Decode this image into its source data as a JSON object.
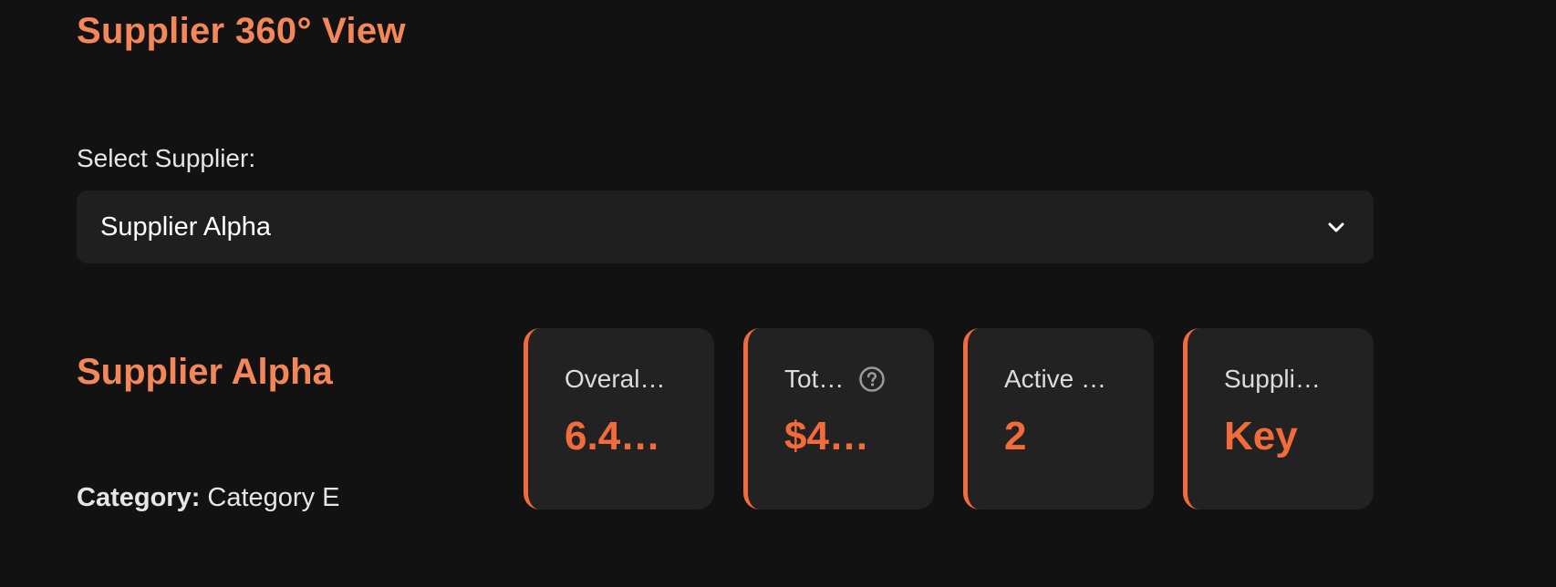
{
  "header": {
    "title": "Supplier 360° View"
  },
  "selector": {
    "label": "Select Supplier:",
    "selected": "Supplier Alpha",
    "icon": "chevron-down-icon"
  },
  "supplier": {
    "name": "Supplier Alpha",
    "category_label": "Category:",
    "category_value": "Category E"
  },
  "metrics": [
    {
      "label": "Overal…",
      "value": "6.4…"
    },
    {
      "label": "Tot…",
      "value": "$4…",
      "help_icon": "question-circle-icon"
    },
    {
      "label": "Active …",
      "value": "2"
    },
    {
      "label": "Suppli…",
      "value": "Key"
    }
  ],
  "colors": {
    "background": "#121212",
    "accent": "#f26b3a",
    "title_accent": "#f4875a",
    "card": "#222222",
    "input": "#1f1f1f"
  }
}
